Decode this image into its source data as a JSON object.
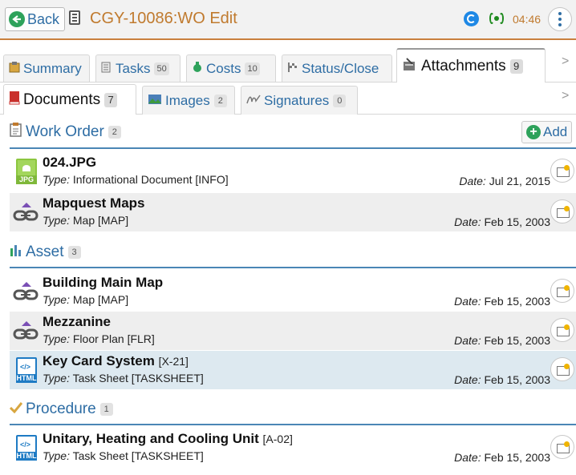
{
  "header": {
    "back_label": "Back",
    "title": "CGY-10086:WO Edit",
    "time": "04:46"
  },
  "tabs": [
    {
      "label": "Summary",
      "icon": "clipboard-icon"
    },
    {
      "label": "Tasks",
      "count": "50",
      "icon": "tasks-icon"
    },
    {
      "label": "Costs",
      "count": "10",
      "icon": "costs-icon"
    },
    {
      "label": "Status/Close",
      "icon": "flag-icon"
    },
    {
      "label": "Attachments",
      "count": "9",
      "icon": "attachments-icon",
      "active": true
    }
  ],
  "subtabs": [
    {
      "label": "Documents",
      "count": "7",
      "icon": "book-icon",
      "active": true
    },
    {
      "label": "Images",
      "count": "2",
      "icon": "images-icon"
    },
    {
      "label": "Signatures",
      "count": "0",
      "icon": "signature-icon"
    }
  ],
  "scroll_arrow": ">",
  "add_label": "Add",
  "type_prefix": "Type:",
  "date_prefix": "Date:",
  "sections": [
    {
      "title": "Work Order",
      "count": "2",
      "items": [
        {
          "name": "024.JPG",
          "code": "",
          "type": "Informational Document [INFO]",
          "date": "Jul 21, 2015",
          "icon": "jpg-file-icon"
        },
        {
          "name": "Mapquest Maps",
          "code": "",
          "type": "Map [MAP]",
          "date": "Feb 15, 2003",
          "icon": "link-icon"
        }
      ]
    },
    {
      "title": "Asset",
      "count": "3",
      "items": [
        {
          "name": "Building Main Map",
          "code": "",
          "type": "Map [MAP]",
          "date": "Feb 15, 2003",
          "icon": "link-icon"
        },
        {
          "name": "Mezzanine",
          "code": "",
          "type": "Floor Plan [FLR]",
          "date": "Feb 15, 2003",
          "icon": "link-icon"
        },
        {
          "name": "Key Card System",
          "code": "[X-21]",
          "type": "Task Sheet [TASKSHEET]",
          "date": "Feb 15, 2003",
          "icon": "html-file-icon"
        }
      ]
    },
    {
      "title": "Procedure",
      "count": "1",
      "items": [
        {
          "name": "Unitary, Heating and Cooling Unit",
          "code": "[A-02]",
          "type": "Task Sheet [TASKSHEET]",
          "date": "Feb 15, 2003",
          "icon": "html-file-icon"
        }
      ]
    }
  ],
  "colors": {
    "accent": "#2e6da4",
    "title": "#c07a2e",
    "section_line": "#4a86b5",
    "selected_row": "#dde9f0",
    "alt_row": "#eeeeee"
  }
}
